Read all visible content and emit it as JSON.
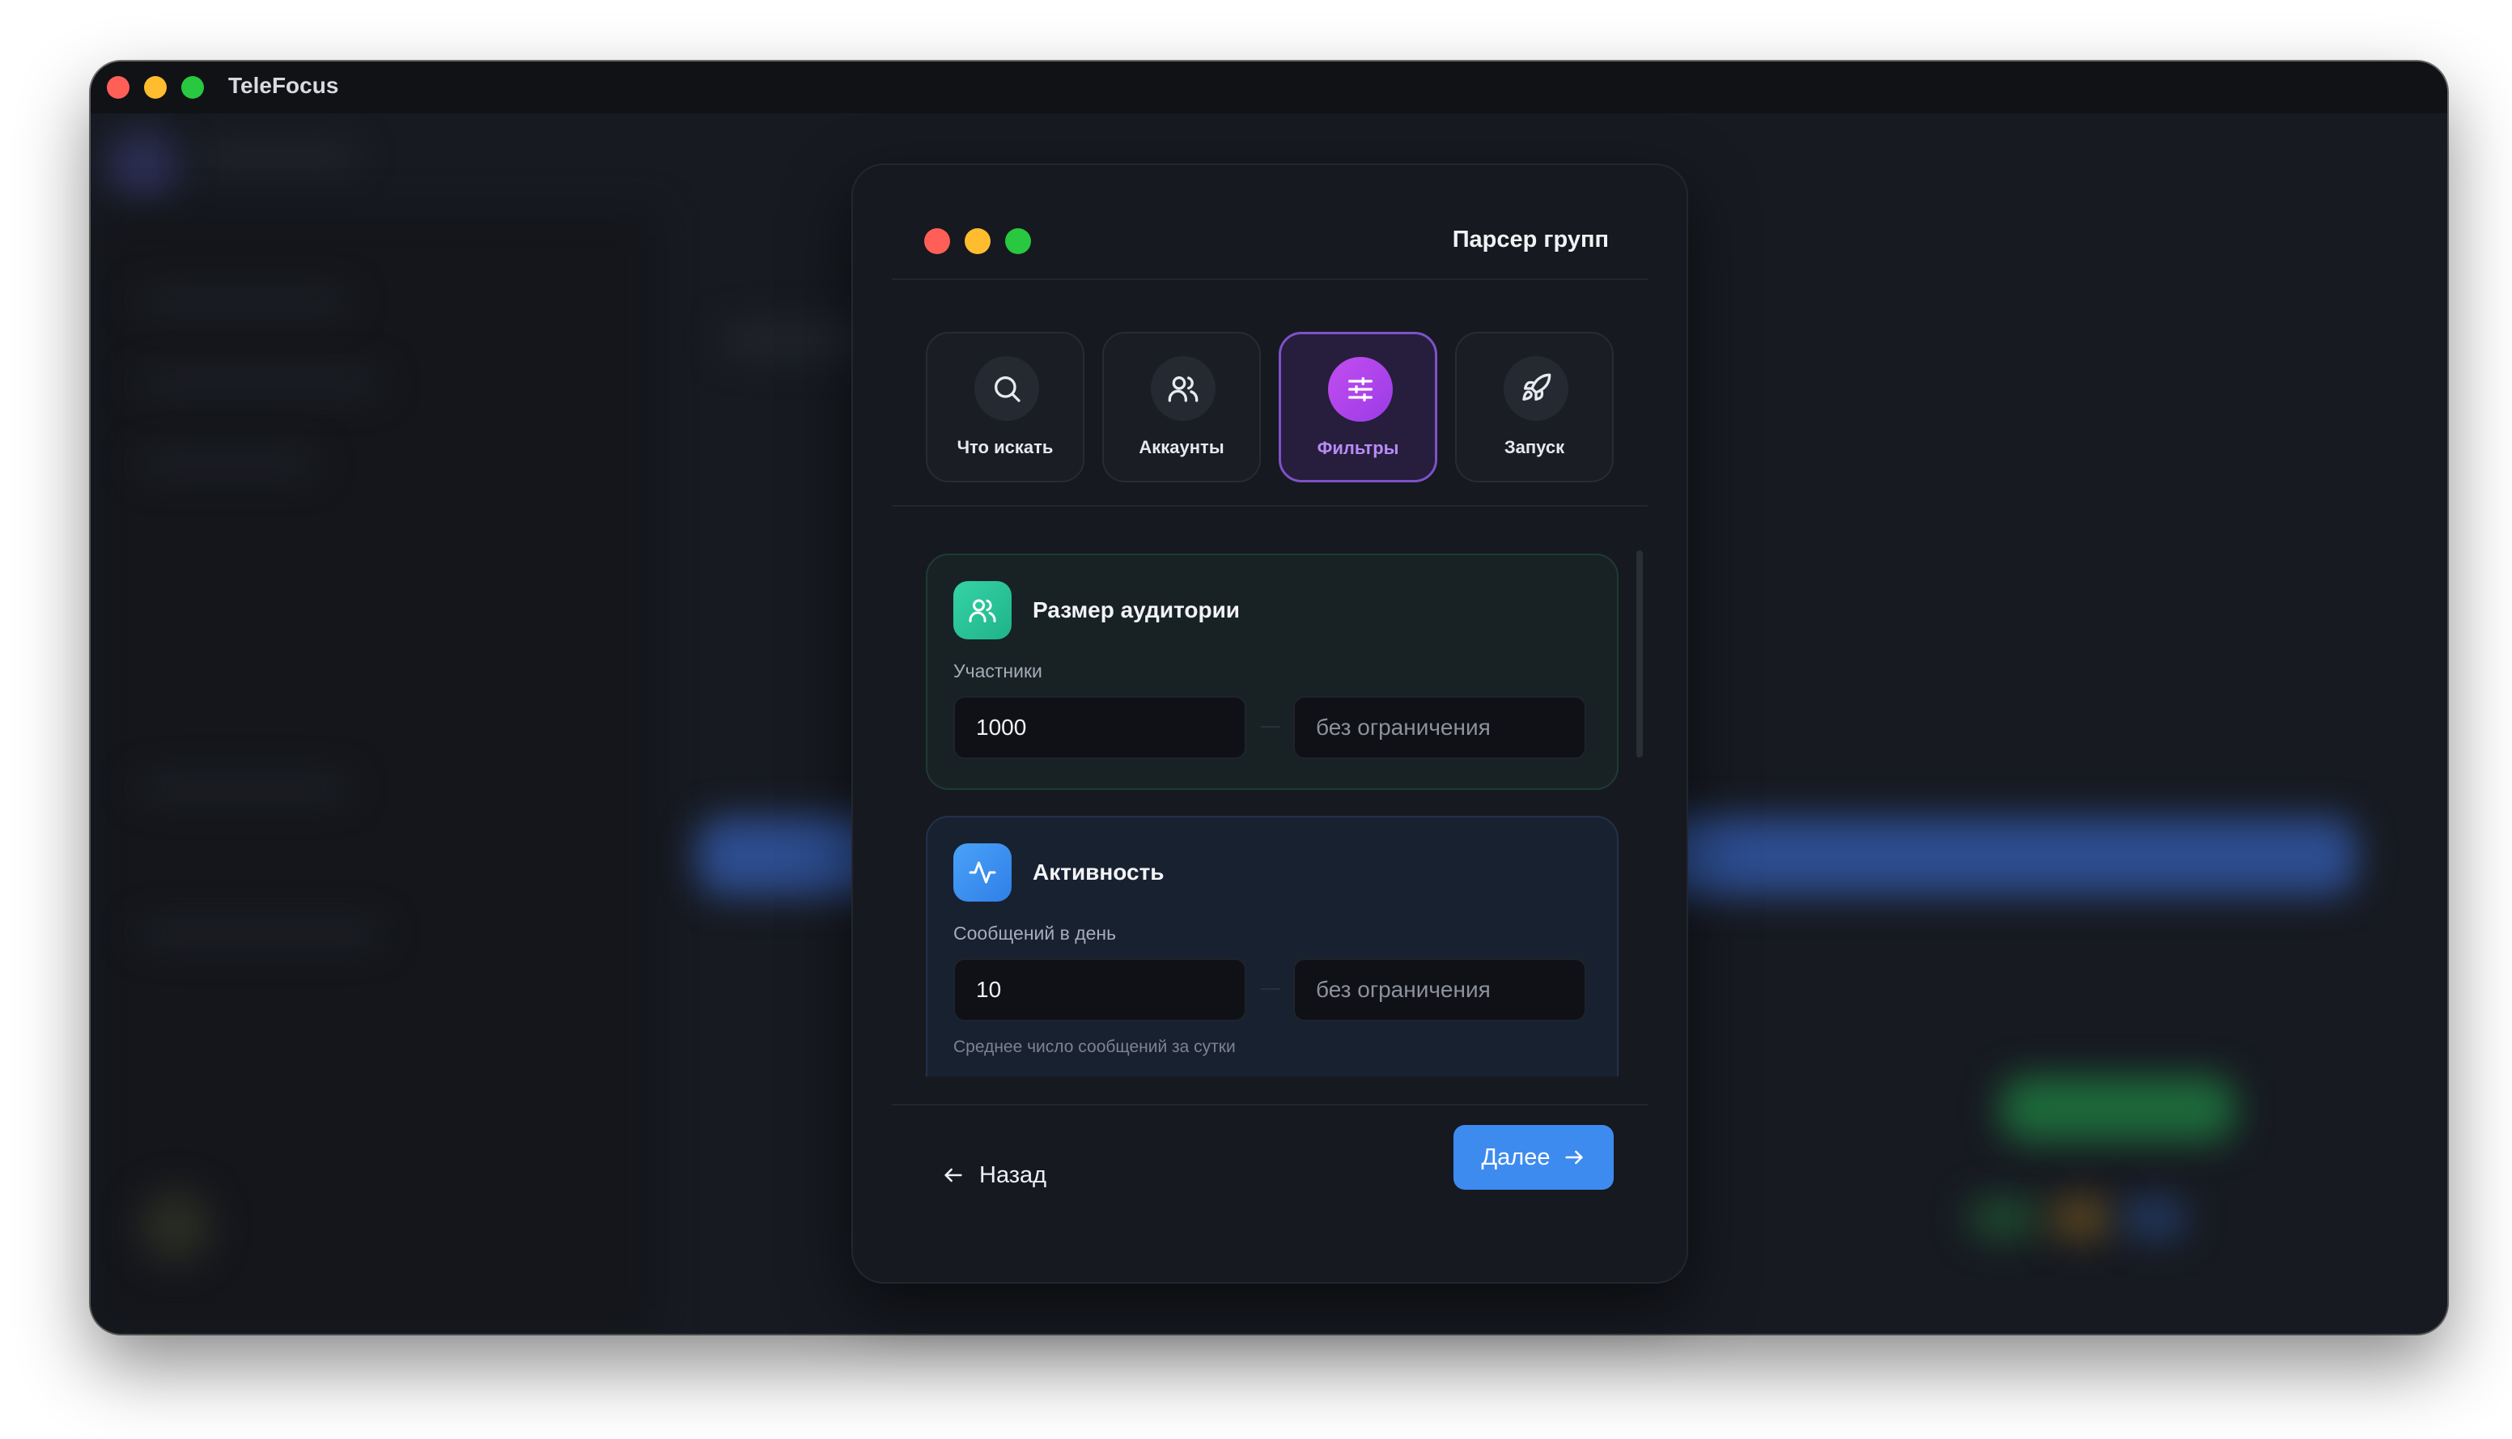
{
  "window": {
    "title": "TeleFocus",
    "traffic_lights": [
      "#ff5f57",
      "#febc2e",
      "#28c840"
    ]
  },
  "modal": {
    "title": "Парсер групп",
    "traffic_lights": [
      "#ff5f57",
      "#febc2e",
      "#28c840"
    ],
    "steps": [
      {
        "label": "Что искать",
        "icon": "search-icon",
        "active": false
      },
      {
        "label": "Аккаунты",
        "icon": "users-icon",
        "active": false
      },
      {
        "label": "Фильтры",
        "icon": "sliders-icon",
        "active": true
      },
      {
        "label": "Запуск",
        "icon": "rocket-icon",
        "active": false
      }
    ],
    "audience": {
      "title": "Размер аудитории",
      "icon": "users-icon",
      "color": "#2fc79c",
      "field_label": "Участники",
      "min_value": "1000",
      "max_placeholder": "без ограничения"
    },
    "activity": {
      "title": "Активность",
      "icon": "activity-icon",
      "color": "#3b91f2",
      "field_label": "Сообщений в день",
      "min_value": "10",
      "max_placeholder": "без ограничения",
      "hint": "Среднее число сообщений за сутки"
    },
    "footer": {
      "back_label": "Назад",
      "next_label": "Далее",
      "next_color": "#3e8bf0"
    }
  },
  "colors": {
    "accent_purple": "#a855f7",
    "background": "#16191f"
  }
}
